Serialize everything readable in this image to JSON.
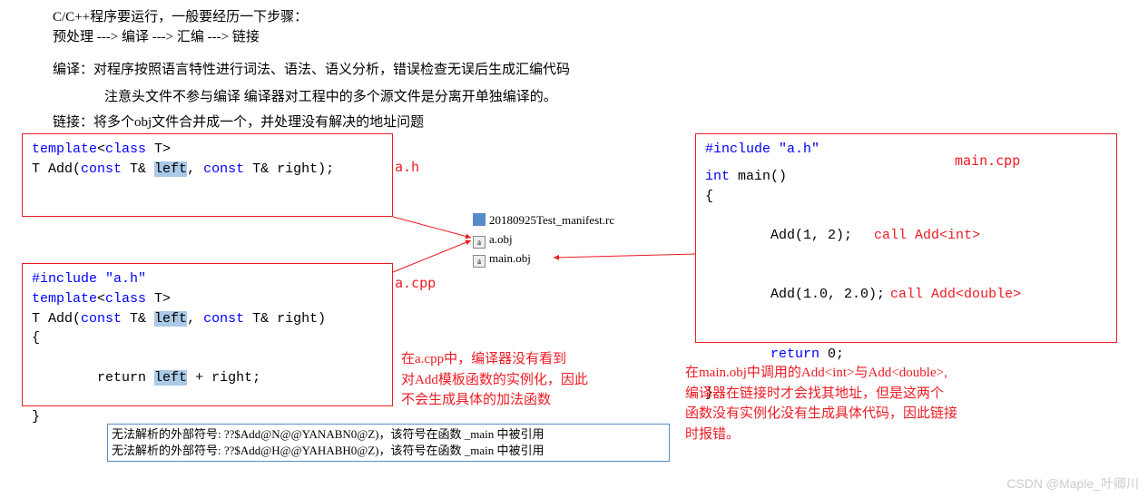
{
  "intro": {
    "l1": "C/C++程序要运行，一般要经历一下步骤：",
    "l2": "预处理 ---> 编译 ---> 汇编 ---> 链接",
    "l3": "编译：对程序按照语言特性进行词法、语法、语义分析，错误检查无误后生成汇编代码",
    "l4": "注意头文件不参与编译 编译器对工程中的多个源文件是分离开单独编译的。",
    "l5": "链接：将多个obj文件合并成一个，并处理没有解决的地址问题"
  },
  "ah": {
    "label": "a.h",
    "line1_a": "template",
    "line1_b": "<",
    "line1_c": "class",
    "line1_d": " T>",
    "line2_a": "T Add(",
    "line2_b": "const",
    "line2_c": " T& ",
    "line2_d": "left",
    "line2_e": ", ",
    "line2_f": "const",
    "line2_g": " T& right);"
  },
  "acpp": {
    "label": "a.cpp",
    "l1": "#include \"a.h\"",
    "l2a": "template",
    "l2b": "<",
    "l2c": "class",
    "l2d": " T>",
    "l3a": "T Add(",
    "l3b": "const",
    "l3c": " T& ",
    "l3d": "left",
    "l3e": ", ",
    "l3f": "const",
    "l3g": " T& right)",
    "l4": "{",
    "l5a": "    return ",
    "l5b": "left",
    "l5c": " + right;",
    "l6": "}"
  },
  "maincpp": {
    "label": "main.cpp",
    "l1": "#include \"a.h\"",
    "l2a": "int",
    "l2b": " main()",
    "l3": "{",
    "l4": "    Add(1, 2);",
    "l4note": "call Add<int>",
    "l5": "    Add(1.0, 2.0);",
    "l5note": "call Add<double>",
    "l6a": "    return",
    "l6b": " 0;",
    "l7": "}"
  },
  "files": {
    "f1": "20180925Test_manifest.rc",
    "f2": "a.obj",
    "f3": "main.obj"
  },
  "note_a": {
    "l1": "在a.cpp中，编译器没有看到",
    "l2": "对Add模板函数的实例化，因此",
    "l3": "不会生成具体的加法函数"
  },
  "note_main": {
    "l1": "在main.obj中调用的Add<int>与Add<double>,",
    "l2": "编译器在链接时才会找其地址，但是这两个",
    "l3": "函数没有实例化没有生成具体代码，因此链接",
    "l4": "时报错。"
  },
  "err": {
    "l1": "无法解析的外部符号: ??$Add@N@@YANABN0@Z)，该符号在函数 _main 中被引用",
    "l2": "无法解析的外部符号: ??$Add@H@@YAHABH0@Z)，该符号在函数 _main 中被引用"
  },
  "watermark": "CSDN @Maple_叶卿川"
}
